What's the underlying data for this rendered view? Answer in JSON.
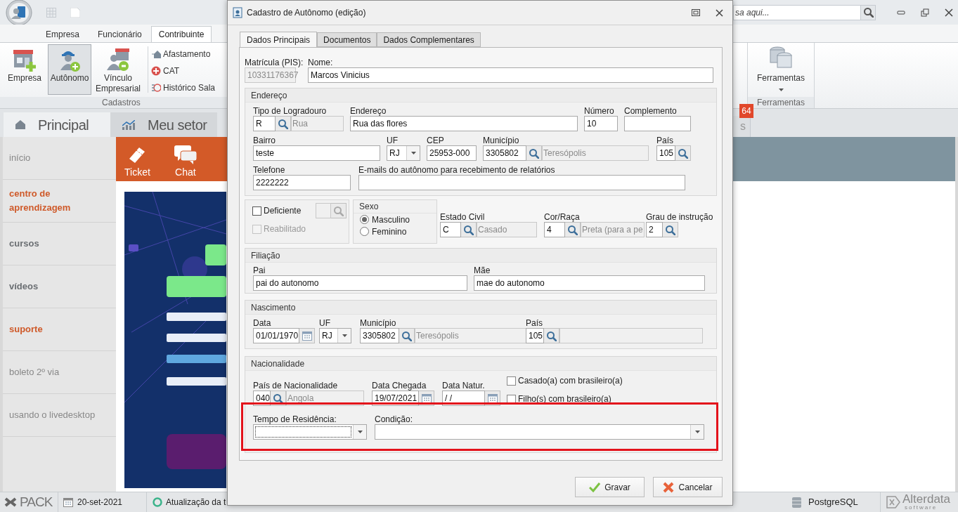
{
  "app": {
    "search_placeholder": "sa aqui...",
    "ribbon_tabs": [
      {
        "label": "Empresa",
        "selected": false
      },
      {
        "label": "Funcionário",
        "selected": false
      },
      {
        "label": "Contribuinte",
        "selected": true
      }
    ],
    "ribbon_buttons": [
      {
        "label": "Empresa",
        "kind": "company",
        "selected": false
      },
      {
        "label": "Autônomo",
        "kind": "worker",
        "selected": true
      },
      {
        "label": "Vínculo Empresarial",
        "kind": "link",
        "selected": false
      }
    ],
    "ribbon_small_items": [
      {
        "label": "Afastamento",
        "kind": "leave"
      },
      {
        "label": "CAT",
        "kind": "accident"
      },
      {
        "label": "Histórico Sala",
        "kind": "history"
      }
    ],
    "group_label": "Cadastros",
    "tools_button": "Ferramentas",
    "tools_group_label": "Ferramentas",
    "notification_badge": "64",
    "home_tabs": [
      {
        "label": "Principal",
        "kind": "home",
        "selected": true
      },
      {
        "label": "Meu setor",
        "kind": "chart",
        "selected": false
      }
    ],
    "partial_tab": "s",
    "sidebar": [
      {
        "label": "início",
        "kind": "plain"
      },
      {
        "label": "centro de aprendizagem",
        "kind": "accent"
      },
      {
        "label": "cursos",
        "kind": "bold"
      },
      {
        "label": "vídeos",
        "kind": "bold"
      },
      {
        "label": "suporte",
        "kind": "accent"
      },
      {
        "label": "boleto 2º via",
        "kind": "plain"
      },
      {
        "label": "usando o livedesktop",
        "kind": "plain"
      }
    ],
    "quick_actions": [
      {
        "label": "Ticket",
        "kind": "ticket"
      },
      {
        "label": "Chat",
        "kind": "chat"
      }
    ],
    "status_bar": {
      "product": "PACK",
      "date": "20-set-2021",
      "task": "Atualização da t",
      "database": "PostgreSQL",
      "brand": "Alterdata",
      "brand_tagline": "software"
    }
  },
  "dialog": {
    "title": "Cadastro de Autônomo (edição)",
    "tabs": [
      {
        "label": "Dados Principais",
        "selected": true
      },
      {
        "label": "Documentos",
        "selected": false
      },
      {
        "label": "Dados Complementares",
        "selected": false
      }
    ],
    "matricula": {
      "label": "Matrícula (PIS):",
      "value": "10331176367",
      "disabled": true
    },
    "nome": {
      "label": "Nome:",
      "value": "Marcos Vinicius"
    },
    "endereco": {
      "title": "Endereço",
      "lines": [
        [
          {
            "kind": "lookup",
            "label": "Tipo de Logradouro",
            "value": "R",
            "description": "Rua"
          },
          {
            "kind": "text",
            "label": "Endereço",
            "value": "Rua das flores"
          },
          {
            "kind": "text",
            "label": "Número",
            "value": "10"
          },
          {
            "kind": "text",
            "label": "Complemento"
          }
        ],
        [
          {
            "kind": "text",
            "label": "Bairro",
            "value": "teste"
          },
          {
            "kind": "combo",
            "label": "UF",
            "value": "RJ"
          },
          {
            "kind": "text",
            "label": "CEP",
            "value": "25953-000"
          },
          {
            "kind": "lookup",
            "label": "Município",
            "value": "3305802",
            "description": "Teresópolis"
          },
          {
            "kind": "lookup",
            "label": "País",
            "value": "105"
          }
        ],
        [
          {
            "kind": "text",
            "label": "Telefone",
            "value": "2222222"
          },
          {
            "kind": "text",
            "label": "E-mails do autônomo para recebimento de relatórios"
          }
        ]
      ]
    },
    "deficiencia": [
      {
        "label": "Deficiente",
        "checked": false,
        "disabled": false
      },
      {
        "label": "Reabilitado",
        "checked": false,
        "disabled": true
      }
    ],
    "sexo": {
      "title": "Sexo",
      "options": [
        {
          "label": "Masculino",
          "selected": true
        },
        {
          "label": "Feminino",
          "selected": false
        }
      ]
    },
    "pessoais": [
      {
        "kind": "lookup",
        "label": "Estado Civil",
        "value": "C",
        "description": "Casado"
      },
      {
        "kind": "lookup",
        "label": "Cor/Raça",
        "value": "4",
        "description": "Preta (para a pe"
      },
      {
        "kind": "lookup",
        "label": "Grau de instrução",
        "value": "2"
      }
    ],
    "filiacao": {
      "title": "Filiação",
      "lines": [
        [
          {
            "kind": "text",
            "label": "Pai",
            "value": "pai do autonomo"
          },
          {
            "kind": "text",
            "label": "Mãe",
            "value": "mae do autonomo"
          }
        ]
      ]
    },
    "nascimento": {
      "title": "Nascimento",
      "lines": [
        [
          {
            "kind": "date",
            "label": "Data",
            "value": "01/01/1970"
          },
          {
            "kind": "combo",
            "label": "UF",
            "value": "RJ"
          },
          {
            "kind": "lookup",
            "label": "Município",
            "value": "3305802",
            "description": "Teresópolis"
          },
          {
            "kind": "lookup",
            "label": "País",
            "value": "105",
            "empty_description": true
          }
        ]
      ]
    },
    "nacionalidade": {
      "title": "Nacionalidade",
      "lines": [
        [
          {
            "kind": "lookup",
            "label": "País de Nacionalidade",
            "value": "040",
            "description": "Angola"
          },
          {
            "kind": "date",
            "label": "Data Chegada",
            "value": "19/07/2021"
          },
          {
            "kind": "date",
            "label": "Data Natur.",
            "value": "/ /"
          }
        ],
        [
          {
            "kind": "combo",
            "label": "Tempo de Residência:",
            "focused": true
          },
          {
            "kind": "combo",
            "label": "Condição:",
            "focused": false
          }
        ]
      ],
      "checkboxes": [
        {
          "label": "Casado(a) com brasileiro(a)",
          "checked": false
        },
        {
          "label": "Filho(s) com brasileiro(a)",
          "checked": false
        }
      ]
    },
    "buttons": [
      {
        "label": "Gravar",
        "kind": "confirm"
      },
      {
        "label": "Cancelar",
        "kind": "cancel"
      }
    ]
  }
}
